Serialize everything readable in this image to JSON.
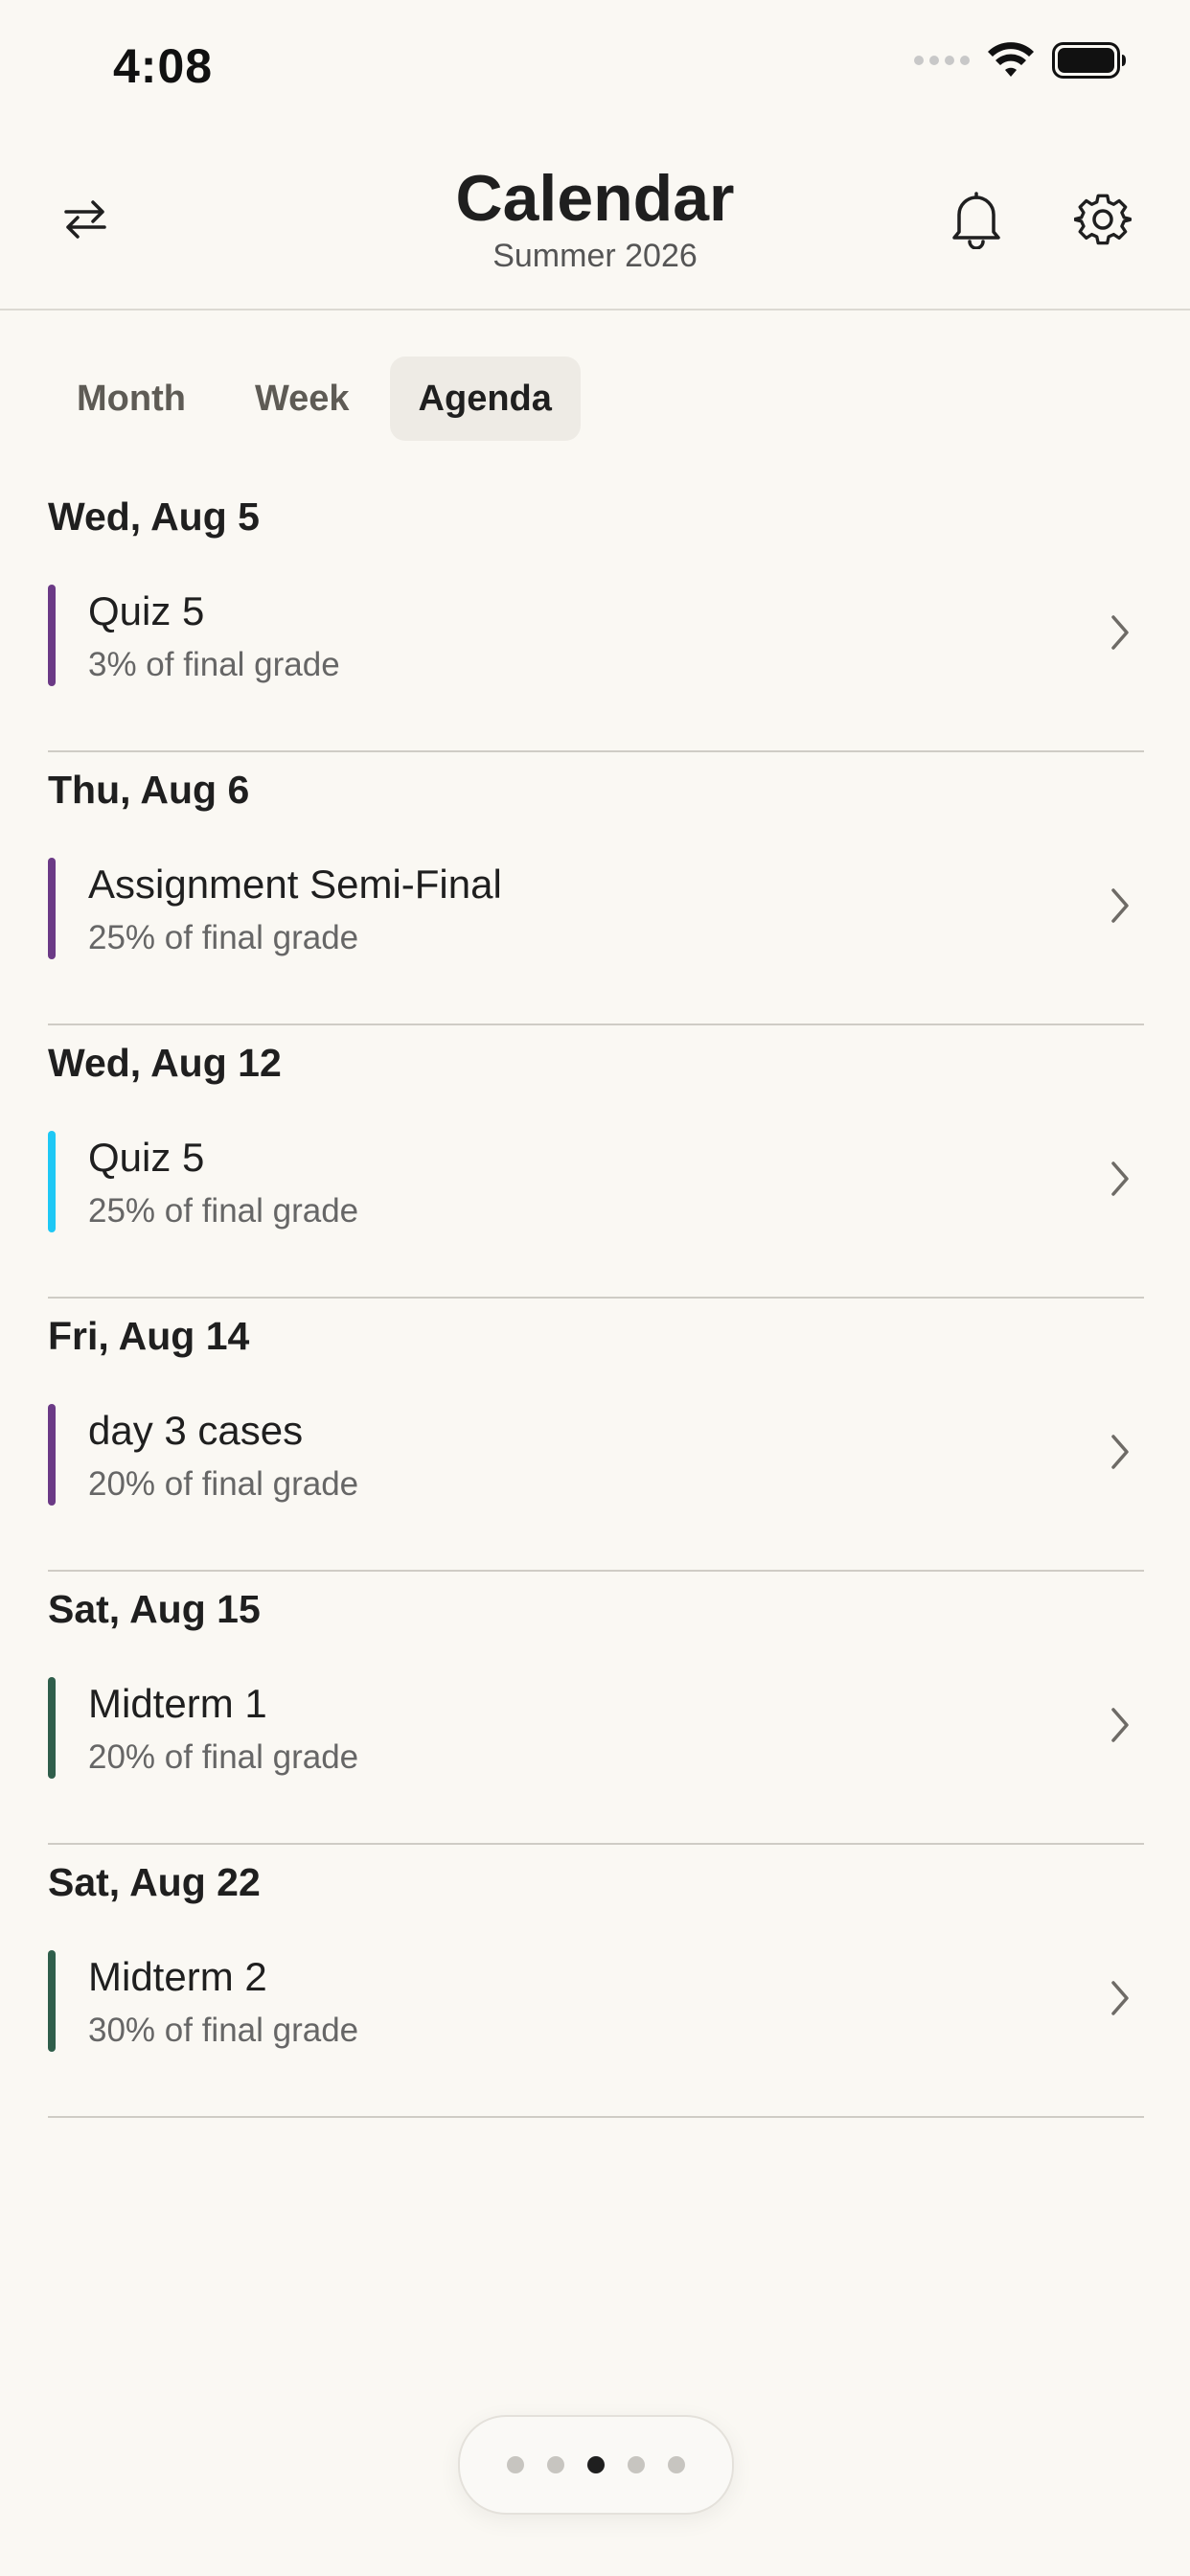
{
  "status_bar": {
    "time": "4:08"
  },
  "header": {
    "title": "Calendar",
    "subtitle": "Summer 2026"
  },
  "tabs": [
    {
      "label": "Month",
      "active": false
    },
    {
      "label": "Week",
      "active": false
    },
    {
      "label": "Agenda",
      "active": true
    }
  ],
  "agenda": [
    {
      "date": "Wed, Aug 5",
      "event": {
        "title": "Quiz 5",
        "detail": "3% of final grade",
        "color": "#6B3A86"
      }
    },
    {
      "date": "Thu, Aug 6",
      "event": {
        "title": "Assignment Semi-Final",
        "detail": "25% of final grade",
        "color": "#6B3A86"
      }
    },
    {
      "date": "Wed, Aug 12",
      "event": {
        "title": "Quiz 5",
        "detail": "25% of final grade",
        "color": "#1EC8F5"
      }
    },
    {
      "date": "Fri, Aug 14",
      "event": {
        "title": "day 3 cases",
        "detail": "20% of final grade",
        "color": "#6B3A86"
      }
    },
    {
      "date": "Sat, Aug 15",
      "event": {
        "title": "Midterm 1",
        "detail": "20% of final grade",
        "color": "#2F5E4B"
      }
    },
    {
      "date": "Sat, Aug 22",
      "event": {
        "title": "Midterm 2",
        "detail": "30% of final grade",
        "color": "#2F5E4B"
      }
    }
  ],
  "pager": {
    "pages": 5,
    "current": 3
  },
  "icons": {
    "swap": "swap-arrows-icon",
    "notifications": "bell-icon",
    "settings": "gear-icon",
    "chevron": "chevron-right-icon"
  }
}
